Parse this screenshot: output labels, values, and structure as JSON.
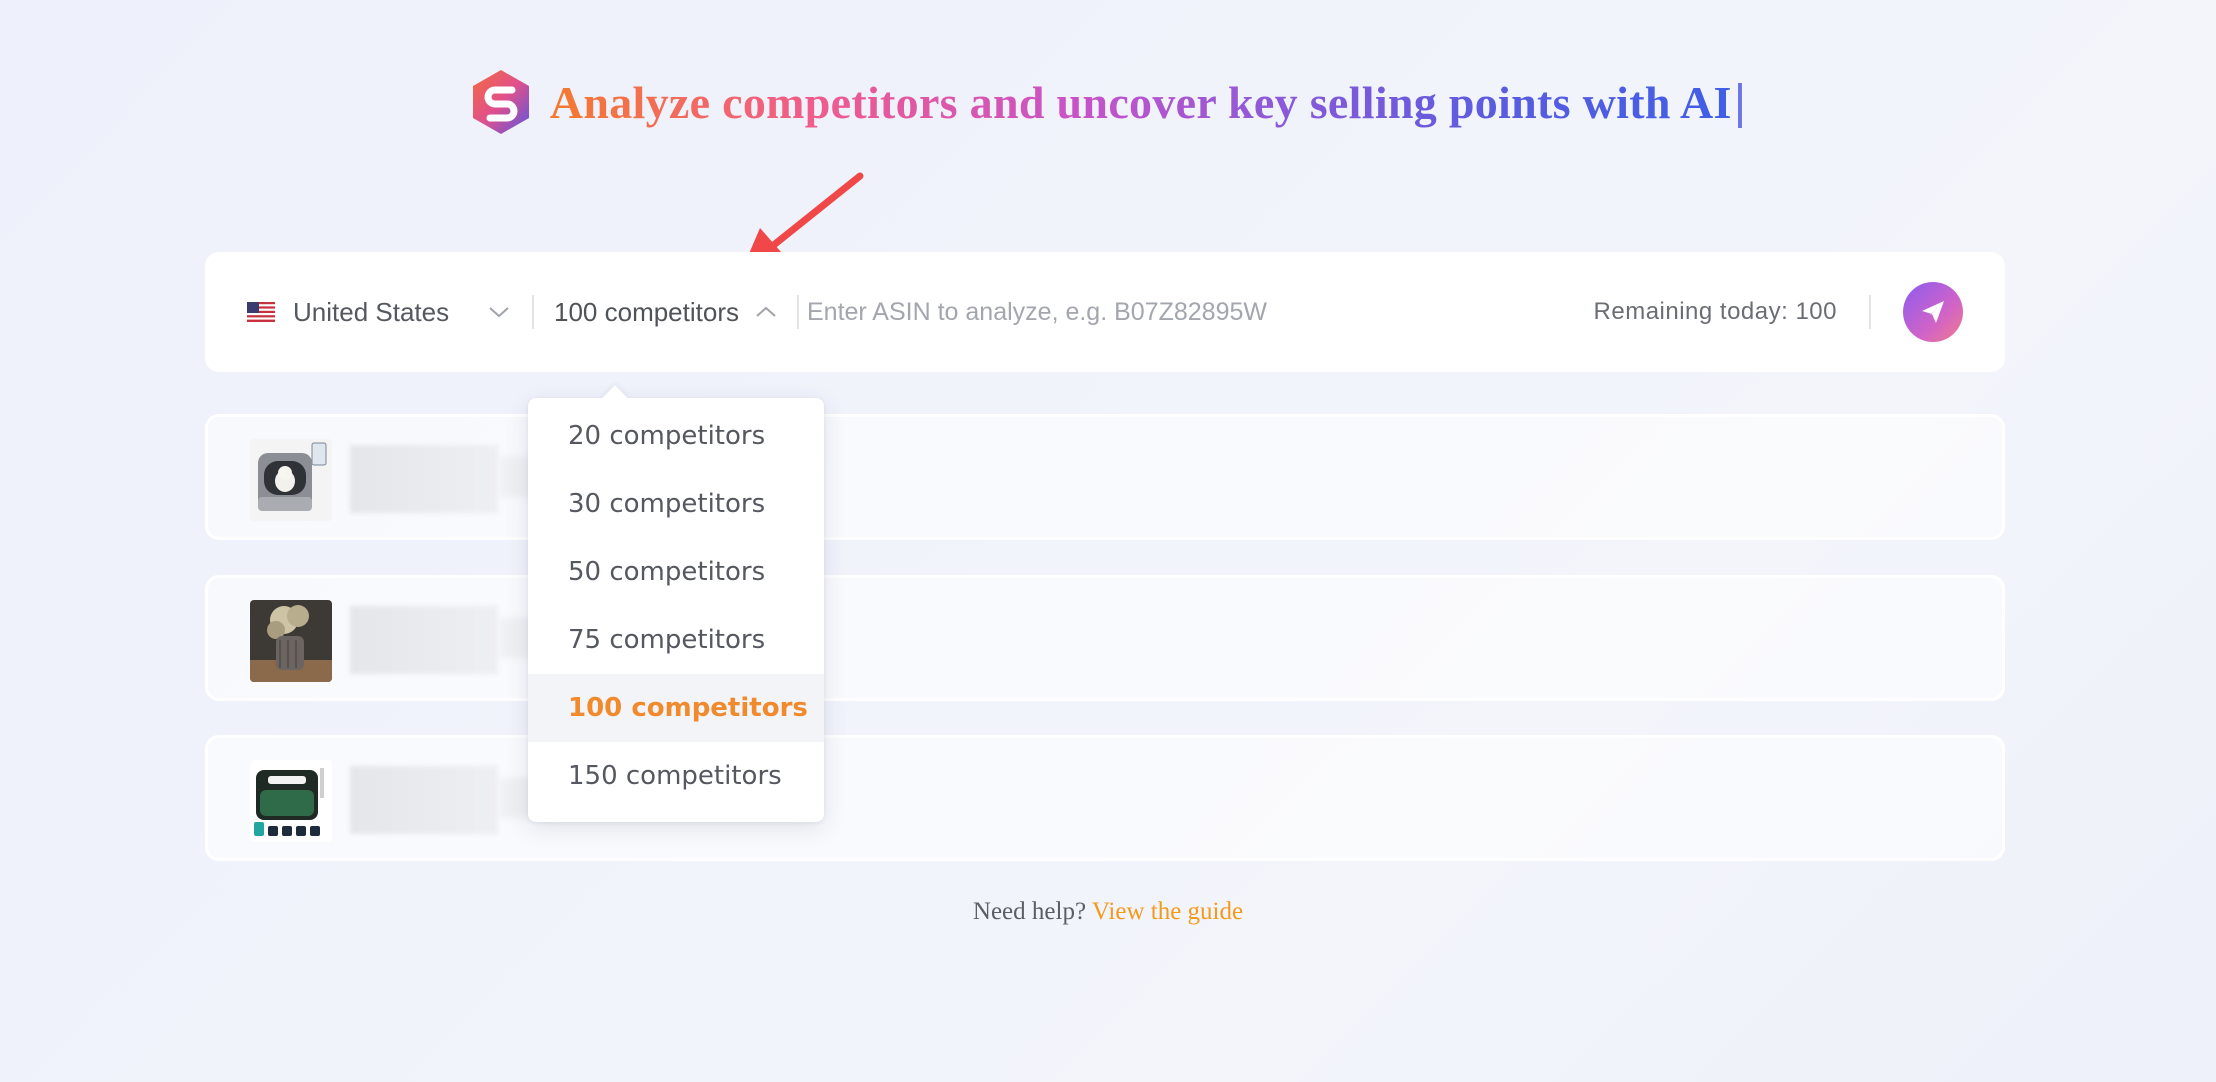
{
  "header": {
    "logo_icon": "s-hexagon-logo-icon",
    "headline": "Analyze competitors and uncover key selling points with AI",
    "cursor": "|"
  },
  "search": {
    "country": "United States",
    "country_flag_icon": "us-flag-icon",
    "competitors_selected": "100 competitors",
    "asin_placeholder": "Enter ASIN to analyze, e.g. B07Z82895W",
    "asin_value": "",
    "remaining": "Remaining today: 100",
    "send_icon": "paper-plane-icon"
  },
  "dropdown": {
    "options": [
      "20 competitors",
      "30 competitors",
      "50 competitors",
      "75 competitors",
      "100 competitors",
      "150 competitors"
    ],
    "selected_index": 4
  },
  "products": [
    {
      "thumb": "cat-litter-box-image"
    },
    {
      "thumb": "dried-flower-vase-image"
    },
    {
      "thumb": "cooler-bag-set-image"
    }
  ],
  "help": {
    "prefix": "Need help?",
    "link": "View the guide"
  },
  "colors": {
    "accent_orange": "#f08a2c",
    "annotation_red": "#f04848",
    "link_orange": "#f39a1d"
  }
}
